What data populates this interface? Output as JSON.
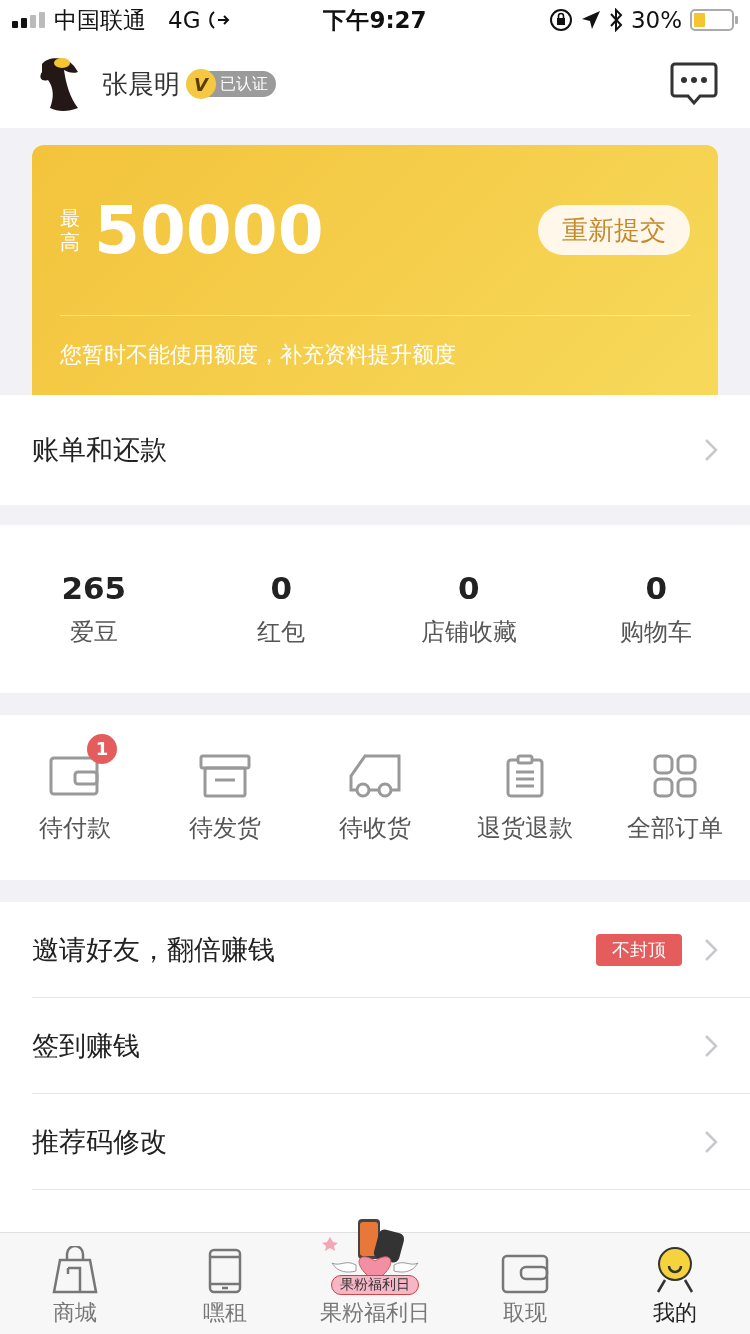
{
  "status_bar": {
    "carrier": "中国联通",
    "network": "4G",
    "time": "下午9:27",
    "battery": "30%"
  },
  "header": {
    "username": "张晨明",
    "verified_badge": "已认证",
    "verified_mark": "V"
  },
  "credit_card": {
    "prefix": "最高",
    "amount": "50000",
    "button": "重新提交",
    "note": "您暂时不能使用额度，补充资料提升额度"
  },
  "bill_row": {
    "label": "账单和还款"
  },
  "stats": [
    {
      "value": "265",
      "label": "爱豆"
    },
    {
      "value": "0",
      "label": "红包"
    },
    {
      "value": "0",
      "label": "店铺收藏"
    },
    {
      "value": "0",
      "label": "购物车"
    }
  ],
  "orders": [
    {
      "kind": "wallet",
      "label": "待付款",
      "badge": "1"
    },
    {
      "kind": "box",
      "label": "待发货"
    },
    {
      "kind": "truck",
      "label": "待收货"
    },
    {
      "kind": "clipboard",
      "label": "退货退款"
    },
    {
      "kind": "grid",
      "label": "全部订单"
    }
  ],
  "menu": [
    {
      "label": "邀请好友，翻倍赚钱",
      "tag": "不封顶"
    },
    {
      "label": "签到赚钱"
    },
    {
      "label": "推荐码修改"
    }
  ],
  "tab_bar": [
    {
      "kind": "bag",
      "label": "商城",
      "selected": false
    },
    {
      "kind": "phone",
      "label": "嘿租",
      "selected": false
    },
    {
      "kind": "promo",
      "label": "果粉福利日",
      "promo_label": "果粉福利日",
      "selected": false
    },
    {
      "kind": "wallet",
      "label": "取现",
      "selected": false
    },
    {
      "kind": "smile",
      "label": "我的",
      "selected": true
    }
  ]
}
